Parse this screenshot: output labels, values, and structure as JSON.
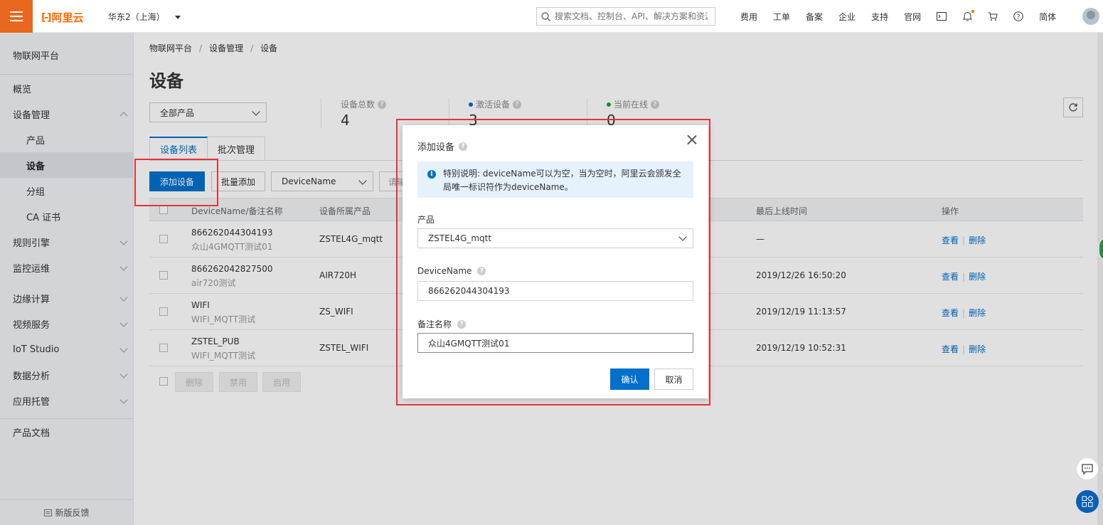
{
  "topbar": {
    "logo_text": "阿里云",
    "region": "华东2（上海）",
    "search_placeholder": "搜索文档、控制台、API、解决方案和资源",
    "nav": [
      "费用",
      "工单",
      "备案",
      "企业",
      "支持",
      "官网"
    ],
    "lang": "简体",
    "icons": [
      "terminal-icon",
      "bell-icon",
      "cart-icon",
      "help-icon"
    ]
  },
  "sidebar": {
    "title": "物联网平台",
    "items": [
      {
        "label": "概览"
      },
      {
        "label": "设备管理"
      },
      {
        "label": "产品"
      },
      {
        "label": "设备"
      },
      {
        "label": "分组"
      },
      {
        "label": "CA 证书"
      },
      {
        "label": "规则引擎"
      },
      {
        "label": "监控运维"
      },
      {
        "label": "边缘计算"
      },
      {
        "label": "视频服务"
      },
      {
        "label": "IoT Studio"
      },
      {
        "label": "数据分析"
      },
      {
        "label": "应用托管"
      },
      {
        "label": "产品文档"
      }
    ],
    "feedback": "新版反馈"
  },
  "main": {
    "breadcrumb": [
      "物联网平台",
      "设备管理",
      "设备"
    ],
    "title": "设备",
    "product_filter": "全部产品",
    "stats": [
      {
        "label": "设备总数",
        "value": "4"
      },
      {
        "label": "激活设备",
        "value": "3"
      },
      {
        "label": "当前在线",
        "value": "0"
      }
    ],
    "tabs": [
      "设备列表",
      "批次管理"
    ],
    "toolbar": {
      "add_device": "添加设备",
      "batch_add": "批量添加",
      "search_field": "DeviceName",
      "search_placeholder": "请输入"
    },
    "table": {
      "headers": [
        "DeviceName/备注名称",
        "设备所属产品",
        "最后上线时间",
        "操作"
      ],
      "rows": [
        {
          "name": "866262044304193",
          "note": "众山4GMQTT测试01",
          "product": "ZSTEL4G_mqtt",
          "last_online": "—"
        },
        {
          "name": "866262042827500",
          "note": "air720测试",
          "product": "AIR720H",
          "last_online": "2019/12/26 16:50:20"
        },
        {
          "name": "WIFI",
          "note": "WIFI_MQTT测试",
          "product": "ZS_WIFI",
          "last_online": "2019/12/19 11:13:57"
        },
        {
          "name": "ZSTEL_PUB",
          "note": "WIFI_MQTT测试",
          "product": "ZSTEL_WIFI",
          "last_online": "2019/12/19 10:52:31"
        }
      ],
      "op_view": "查看",
      "op_delete": "删除",
      "bulk": [
        "删除",
        "禁用",
        "启用"
      ]
    }
  },
  "modal": {
    "title": "添加设备",
    "info": "特别说明: deviceName可以为空，当为空时，阿里云会颁发全局唯一标识符作为deviceName。",
    "product_label": "产品",
    "product_value": "ZSTEL4G_mqtt",
    "devicename_label": "DeviceName",
    "devicename_value": "866262044304193",
    "note_label": "备注名称",
    "note_value": "众山4GMQTT测试01",
    "ok": "确认",
    "cancel": "取消"
  },
  "colors": {
    "brand": "#ff6a00",
    "primary": "#0070cc",
    "highlight": "#e5333c"
  }
}
